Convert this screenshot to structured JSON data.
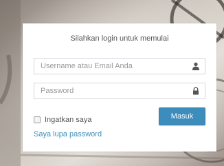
{
  "login": {
    "title": "Silahkan login untuk memulai",
    "username_placeholder": "Username atau Email Anda",
    "username_value": "",
    "password_placeholder": "Password",
    "password_value": "",
    "remember_label": "Ingatkan saya",
    "remember_checked": false,
    "submit_label": "Masuk",
    "forgot_label": "Saya lupa password"
  },
  "icons": {
    "username": "user-icon",
    "password": "lock-icon"
  },
  "colors": {
    "primary": "#3c8dbc",
    "card_background": "#ffffff",
    "input_border": "#d2d6de",
    "text": "#555555",
    "placeholder": "#9a9a9a"
  }
}
